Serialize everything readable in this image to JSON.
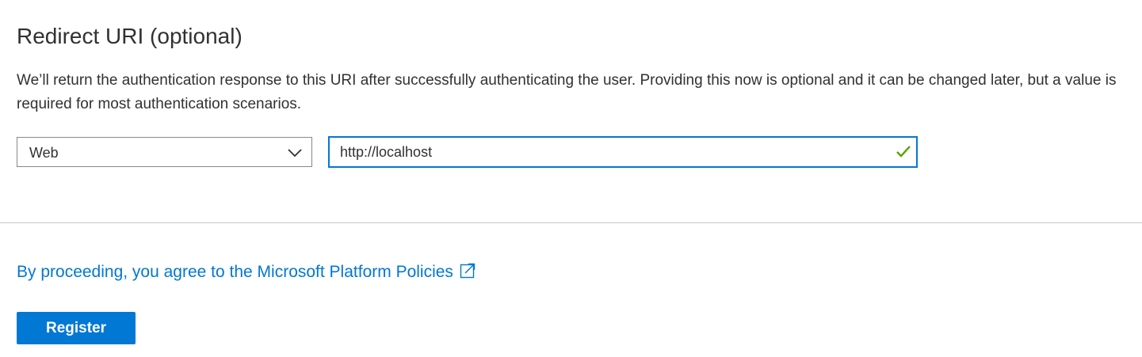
{
  "redirect": {
    "title": "Redirect URI (optional)",
    "description": "We’ll return the authentication response to this URI after successfully authenticating the user. Providing this now is optional and it can be changed later, but a value is required for most authentication scenarios.",
    "platform_select": {
      "selected": "Web",
      "icon": "chevron-down-icon"
    },
    "uri_input": {
      "value": "http://localhost",
      "placeholder": "",
      "valid_icon": "check-icon",
      "valid_color": "#57a300"
    }
  },
  "footer": {
    "policy_link": "By proceeding, you agree to the Microsoft Platform Policies",
    "policy_icon": "external-link-icon",
    "register_label": "Register"
  },
  "colors": {
    "accent": "#0078d4",
    "text": "#323130",
    "border": "#8a8886",
    "divider": "#c8c6c4"
  }
}
